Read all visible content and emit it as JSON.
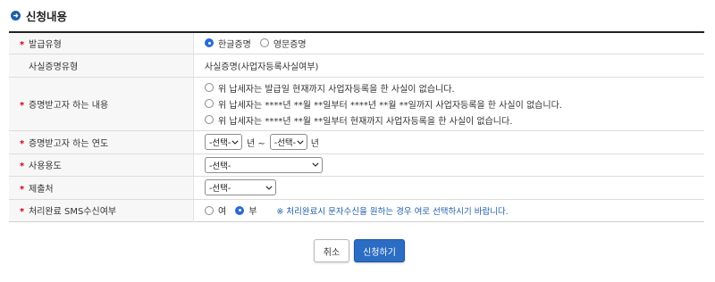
{
  "section": {
    "title": "신청내용",
    "icon": "circle-arrow-right-icon"
  },
  "colors": {
    "accent": "#2a6ad9",
    "required": "#d0021b",
    "note": "#1f5fa8"
  },
  "rows": {
    "issue_type": {
      "label": "발급유형",
      "options": [
        {
          "label": "한글증명",
          "selected": true
        },
        {
          "label": "영문증명",
          "selected": false
        }
      ]
    },
    "cert_type": {
      "label": "사실증명유형",
      "value": "사실증명(사업자등록사실여부)"
    },
    "content": {
      "label": "증명받고자 하는 내용",
      "options": [
        {
          "label": "위 납세자는 발급일 현재까지 사업자등록을 한 사실이 없습니다.",
          "selected": false
        },
        {
          "label": "위 납세자는 ****년 **월 **일부터 ****년 **월 **일까지 사업자등록을 한 사실이 없습니다.",
          "selected": false
        },
        {
          "label": "위 납세자는 ****년 **월 **일부터 현재까지 사업자등록을 한 사실이 없습니다.",
          "selected": false
        }
      ]
    },
    "year": {
      "label": "증명받고자 하는 연도",
      "from_value": "-선택-",
      "sep": "년 ~",
      "to_value": "-선택-",
      "suffix": "년"
    },
    "purpose": {
      "label": "사용용도",
      "value": "-선택-"
    },
    "submit_to": {
      "label": "제출처",
      "value": "-선택-"
    },
    "sms": {
      "label": "처리완료 SMS수신여부",
      "options": [
        {
          "label": "여",
          "selected": false
        },
        {
          "label": "부",
          "selected": true
        }
      ],
      "note": "※ 처리완료시 문자수신을 원하는 경우 여로 선택하시기 바랍니다."
    }
  },
  "buttons": {
    "cancel": "취소",
    "submit": "신청하기"
  }
}
